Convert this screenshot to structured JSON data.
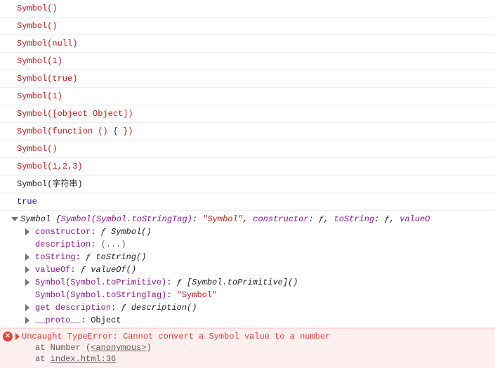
{
  "logs": [
    {
      "text": "Symbol()",
      "cls": "red"
    },
    {
      "text": "Symbol()",
      "cls": "red"
    },
    {
      "text": "Symbol(null)",
      "cls": "red"
    },
    {
      "text": "Symbol(1)",
      "cls": "red"
    },
    {
      "text": "Symbol(true)",
      "cls": "red"
    },
    {
      "text": "Symbol(1)",
      "cls": "red"
    },
    {
      "text": "Symbol([object Object])",
      "cls": "red"
    },
    {
      "text": "Symbol(function () { })",
      "cls": "red"
    },
    {
      "text": "Symbol()",
      "cls": "red"
    },
    {
      "text": "Symbol(1,2,3)",
      "cls": "red"
    },
    {
      "text": "Symbol(字符串)",
      "cls": "black"
    },
    {
      "text": "true",
      "cls": "blue"
    }
  ],
  "object": {
    "header": {
      "name": "Symbol",
      "brace_open": " {",
      "key0": "Symbol(Symbol.toStringTag)",
      "val0": "\"Symbol\"",
      "key1": "constructor",
      "val1": "ƒ",
      "key2": "toString",
      "val2": "ƒ",
      "key3": "valueO",
      "sep": ", ",
      "colon": ": "
    },
    "props": [
      {
        "arrow": true,
        "key": "constructor",
        "keyCls": "purple",
        "sep": ": ",
        "val_pre": "ƒ ",
        "val_it": "Symbol()",
        "valCls": "italic"
      },
      {
        "arrow": false,
        "key": "description",
        "keyCls": "purple",
        "sep": ": ",
        "val_pre": "",
        "val_it": "(...)",
        "valCls": "gray"
      },
      {
        "arrow": true,
        "key": "toString",
        "keyCls": "purple",
        "sep": ": ",
        "val_pre": "ƒ ",
        "val_it": "toString()",
        "valCls": "italic"
      },
      {
        "arrow": true,
        "key": "valueOf",
        "keyCls": "purple",
        "sep": ": ",
        "val_pre": "ƒ ",
        "val_it": "valueOf()",
        "valCls": "italic"
      },
      {
        "arrow": true,
        "key": "Symbol(Symbol.toPrimitive)",
        "keyCls": "purple",
        "sep": ": ",
        "val_pre": "ƒ ",
        "val_it": "[Symbol.toPrimitive]()",
        "valCls": "italic"
      },
      {
        "arrow": false,
        "key": "Symbol(Symbol.toStringTag)",
        "keyCls": "purple",
        "sep": ": ",
        "val_pre": "",
        "val_it": "\"Symbol\"",
        "valCls": "str"
      },
      {
        "arrow": true,
        "key": "get description",
        "keyCls": "purple",
        "sep": ": ",
        "val_pre": "ƒ ",
        "val_it": "description()",
        "valCls": "italic"
      },
      {
        "arrow": true,
        "key": "__proto__",
        "keyCls": "purple",
        "sep": ": ",
        "val_pre": "",
        "val_it": "Object",
        "valCls": "black"
      }
    ]
  },
  "error": {
    "message": "Uncaught TypeError: Cannot convert a Symbol value to a number",
    "stack1_pre": "at Number (",
    "stack1_link": "<anonymous>",
    "stack1_post": ")",
    "stack2_pre": "at ",
    "stack2_link": "index.html:36"
  }
}
